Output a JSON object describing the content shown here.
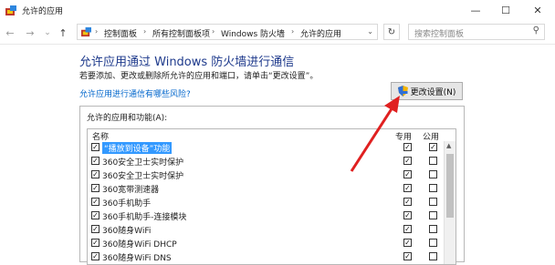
{
  "window": {
    "title": "允许的应用",
    "controls": {
      "minimize": "—",
      "maximize": "☐",
      "close": "✕"
    }
  },
  "nav": {
    "back": "←",
    "forward": "→",
    "recent": "⌄",
    "up": "↑",
    "breadcrumb": [
      "控制面板",
      "所有控制面板项",
      "Windows 防火墙",
      "允许的应用"
    ],
    "separator": "›",
    "dropdown": "⌄",
    "refresh": "↻",
    "search_placeholder": "搜索控制面板",
    "search_icon": "⚲"
  },
  "main": {
    "heading": "允许应用通过 Windows 防火墙进行通信",
    "description": "若要添加、更改或删除所允许的应用和端口，请单击“更改设置”。",
    "risk_link": "允许应用进行通信有哪些风险?",
    "change_settings_button": "更改设置(N)"
  },
  "apps_group": {
    "label": "允许的应用和功能(A):",
    "columns": {
      "name": "名称",
      "private": "专用",
      "public": "公用"
    },
    "rows": [
      {
        "name": "“播放到设备”功能",
        "enabled": true,
        "private": true,
        "public": true,
        "selected": true
      },
      {
        "name": "360安全卫士实时保护",
        "enabled": true,
        "private": true,
        "public": false,
        "selected": false
      },
      {
        "name": "360安全卫士实时保护",
        "enabled": true,
        "private": true,
        "public": false,
        "selected": false
      },
      {
        "name": "360宽带测速器",
        "enabled": true,
        "private": true,
        "public": false,
        "selected": false
      },
      {
        "name": "360手机助手",
        "enabled": true,
        "private": true,
        "public": false,
        "selected": false
      },
      {
        "name": "360手机助手-连接模块",
        "enabled": true,
        "private": true,
        "public": false,
        "selected": false
      },
      {
        "name": "360随身WiFi",
        "enabled": true,
        "private": true,
        "public": false,
        "selected": false
      },
      {
        "name": "360随身WiFi DHCP",
        "enabled": true,
        "private": true,
        "public": false,
        "selected": false
      },
      {
        "name": "360随身WiFi DNS",
        "enabled": true,
        "private": true,
        "public": false,
        "selected": false
      }
    ]
  },
  "colors": {
    "heading": "#1e3a8c",
    "link": "#0066cc",
    "selection": "#3399ff",
    "annotation_arrow": "#e02020"
  },
  "icons": [
    "control-panel-icon",
    "shield-icon",
    "search-icon",
    "refresh-icon",
    "checkbox-icon",
    "red-arrow-annotation"
  ]
}
